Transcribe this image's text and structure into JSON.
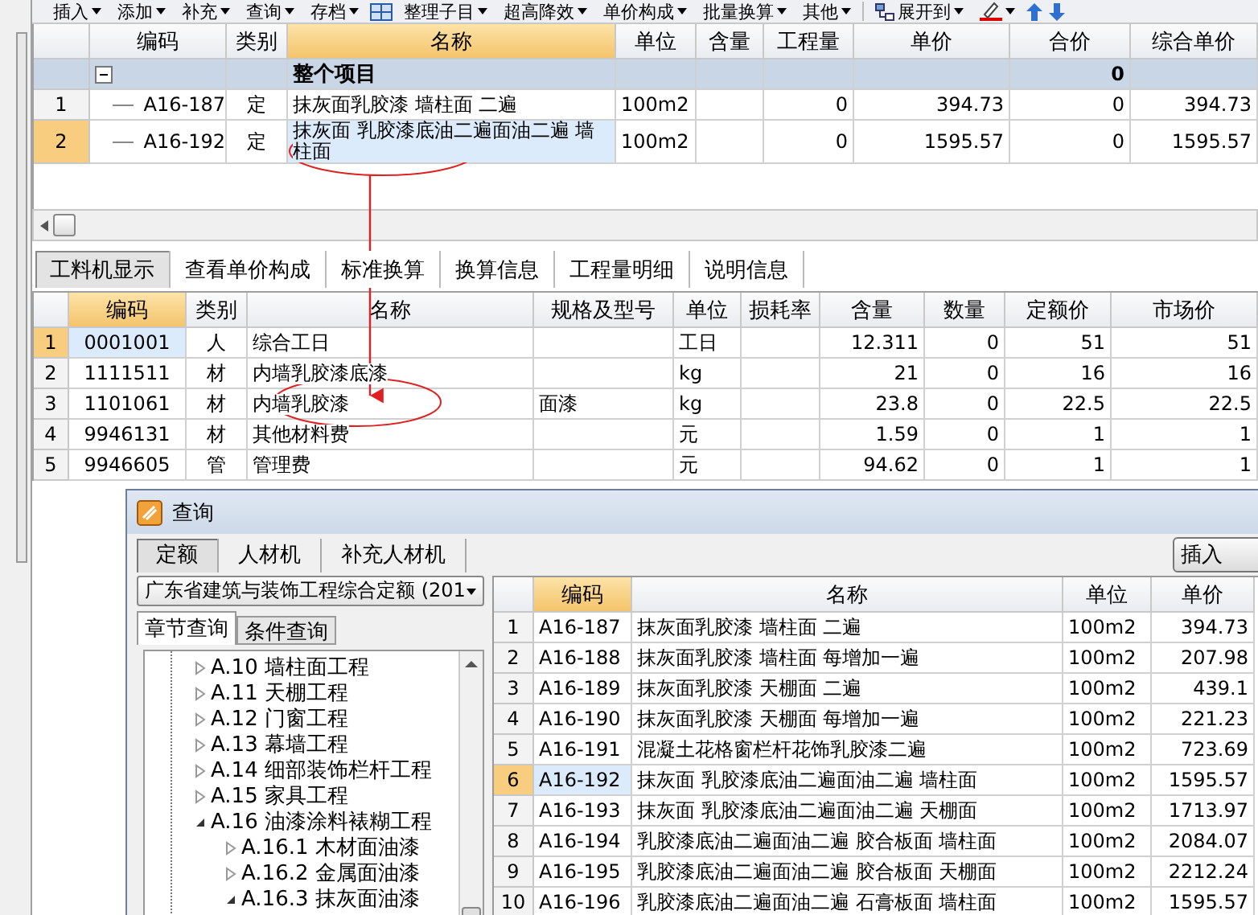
{
  "toolbar": [
    {
      "label": "插入",
      "kind": "menu"
    },
    {
      "label": "添加",
      "kind": "menu"
    },
    {
      "label": "补充",
      "kind": "menu"
    },
    {
      "label": "查询",
      "kind": "menu"
    },
    {
      "label": "存档",
      "kind": "menu"
    },
    {
      "kind": "grid-icon"
    },
    {
      "label": "整理子目",
      "kind": "menu"
    },
    {
      "label": "超高降效",
      "kind": "menu"
    },
    {
      "label": "单价构成",
      "kind": "menu"
    },
    {
      "label": "批量换算",
      "kind": "menu"
    },
    {
      "label": "其他",
      "kind": "menu"
    },
    {
      "label": "展开到",
      "kind": "expand-menu"
    },
    {
      "kind": "color-menu"
    },
    {
      "kind": "up-arrow"
    },
    {
      "kind": "down-arrow"
    }
  ],
  "top_table": {
    "columns": [
      {
        "label": "编码",
        "selected": false
      },
      {
        "label": "类别",
        "selected": false
      },
      {
        "label": "名称",
        "selected": true
      },
      {
        "label": "单位",
        "selected": false
      },
      {
        "label": "含量",
        "selected": false
      },
      {
        "label": "工程量",
        "selected": false
      },
      {
        "label": "单价",
        "selected": false
      },
      {
        "label": "合价",
        "selected": false
      },
      {
        "label": "综合单价",
        "selected": false
      }
    ],
    "rows": [
      {
        "kind": "group",
        "expanded": true,
        "name": "整个项目",
        "total": "0"
      },
      {
        "kind": "item",
        "number": "1",
        "selected": false,
        "cells": [
          "A16-187",
          "定",
          "抹灰面乳胶漆 墙柱面 二遍",
          "100m2",
          null,
          "0",
          "394.73",
          "0",
          "394.73"
        ]
      },
      {
        "kind": "item",
        "number": "2",
        "selected": true,
        "cells": [
          "A16-192",
          "定",
          "抹灰面 乳胶漆底油二遍面油二遍 墙柱面",
          "100m2",
          null,
          "0",
          "1595.57",
          "0",
          "1595.57"
        ]
      }
    ]
  },
  "detail_tabs": [
    {
      "label": "工料机显示",
      "selected": true
    },
    {
      "label": "查看单价构成",
      "selected": false
    },
    {
      "label": "标准换算",
      "selected": false
    },
    {
      "label": "换算信息",
      "selected": false
    },
    {
      "label": "工程量明细",
      "selected": false
    },
    {
      "label": "说明信息",
      "selected": false
    }
  ],
  "detail_table": {
    "columns": [
      {
        "label": "编码",
        "selected": true
      },
      {
        "label": "类别",
        "selected": false
      },
      {
        "label": "名称",
        "selected": false
      },
      {
        "label": "规格及型号",
        "selected": false
      },
      {
        "label": "单位",
        "selected": false
      },
      {
        "label": "损耗率",
        "selected": false
      },
      {
        "label": "含量",
        "selected": false
      },
      {
        "label": "数量",
        "selected": false
      },
      {
        "label": "定额价",
        "selected": false
      },
      {
        "label": "市场价",
        "selected": false
      }
    ],
    "rows": [
      {
        "number": "1",
        "selected": true,
        "cells": [
          "0001001",
          "人",
          "综合工日",
          null,
          "工日",
          null,
          "12.311",
          "0",
          "51",
          "51"
        ]
      },
      {
        "number": "2",
        "selected": false,
        "cells": [
          "1111511",
          "材",
          "内墙乳胶漆底漆",
          null,
          "kg",
          null,
          "21",
          "0",
          "16",
          "16"
        ]
      },
      {
        "number": "3",
        "selected": false,
        "cells": [
          "1101061",
          "材",
          "内墙乳胶漆",
          "面漆",
          "kg",
          null,
          "23.8",
          "0",
          "22.5",
          "22.5"
        ]
      },
      {
        "number": "4",
        "selected": false,
        "cells": [
          "9946131",
          "材",
          "其他材料费",
          null,
          "元",
          null,
          "1.59",
          "0",
          "1",
          "1"
        ]
      },
      {
        "number": "5",
        "selected": false,
        "cells": [
          "9946605",
          "管",
          "管理费",
          null,
          "元",
          null,
          "94.62",
          "0",
          "1",
          "1"
        ]
      }
    ]
  },
  "dialog": {
    "title": "查询",
    "tabs": [
      {
        "label": "定额",
        "selected": true
      },
      {
        "label": "人材机",
        "selected": false
      },
      {
        "label": "补充人材机",
        "selected": false
      }
    ],
    "library_select": {
      "value": "广东省建筑与装饰工程综合定额 (201"
    },
    "search_tabs": [
      {
        "label": "章节查询",
        "selected": true
      },
      {
        "label": "条件查询",
        "selected": false
      }
    ],
    "insert_button": "插入",
    "tree": [
      {
        "label": "A.10 墙柱面工程",
        "expanded": false
      },
      {
        "label": "A.11 天棚工程",
        "expanded": false
      },
      {
        "label": "A.12 门窗工程",
        "expanded": false
      },
      {
        "label": "A.13 幕墙工程",
        "expanded": false
      },
      {
        "label": "A.14 细部装饰栏杆工程",
        "expanded": false
      },
      {
        "label": "A.15 家具工程",
        "expanded": false
      },
      {
        "label": "A.16 油漆涂料裱糊工程",
        "expanded": true,
        "children": [
          {
            "label": "A.16.1 木材面油漆",
            "expanded": false
          },
          {
            "label": "A.16.2 金属面油漆",
            "expanded": false
          },
          {
            "label": "A.16.3 抹灰面油漆",
            "expanded": true
          }
        ]
      }
    ],
    "table": {
      "columns": [
        {
          "label": "编码",
          "selected": true
        },
        {
          "label": "名称",
          "selected": false
        },
        {
          "label": "单位",
          "selected": false
        },
        {
          "label": "单价",
          "selected": false
        }
      ],
      "rows": [
        {
          "number": "1",
          "selected": false,
          "cells": [
            "A16-187",
            "抹灰面乳胶漆 墙柱面 二遍",
            "100m2",
            "394.73"
          ]
        },
        {
          "number": "2",
          "selected": false,
          "cells": [
            "A16-188",
            "抹灰面乳胶漆 墙柱面 每增加一遍",
            "100m2",
            "207.98"
          ]
        },
        {
          "number": "3",
          "selected": false,
          "cells": [
            "A16-189",
            "抹灰面乳胶漆 天棚面 二遍",
            "100m2",
            "439.1"
          ]
        },
        {
          "number": "4",
          "selected": false,
          "cells": [
            "A16-190",
            "抹灰面乳胶漆 天棚面 每增加一遍",
            "100m2",
            "221.23"
          ]
        },
        {
          "number": "5",
          "selected": false,
          "cells": [
            "A16-191",
            "混凝土花格窗栏杆花饰乳胶漆二遍",
            "100m2",
            "723.69"
          ]
        },
        {
          "number": "6",
          "selected": true,
          "cells": [
            "A16-192",
            "抹灰面 乳胶漆底油二遍面油二遍 墙柱面",
            "100m2",
            "1595.57"
          ]
        },
        {
          "number": "7",
          "selected": false,
          "cells": [
            "A16-193",
            "抹灰面 乳胶漆底油二遍面油二遍 天棚面",
            "100m2",
            "1713.97"
          ]
        },
        {
          "number": "8",
          "selected": false,
          "cells": [
            "A16-194",
            "乳胶漆底油二遍面油二遍 胶合板面 墙柱面",
            "100m2",
            "2084.07"
          ]
        },
        {
          "number": "9",
          "selected": false,
          "cells": [
            "A16-195",
            "乳胶漆底油二遍面油二遍 胶合板面 天棚面",
            "100m2",
            "2212.24"
          ]
        },
        {
          "number": "10",
          "selected": false,
          "cells": [
            "A16-196",
            "乳胶漆底油二遍面油二遍 石膏板面 墙柱面",
            "100m2",
            "1595.57"
          ]
        }
      ]
    }
  }
}
